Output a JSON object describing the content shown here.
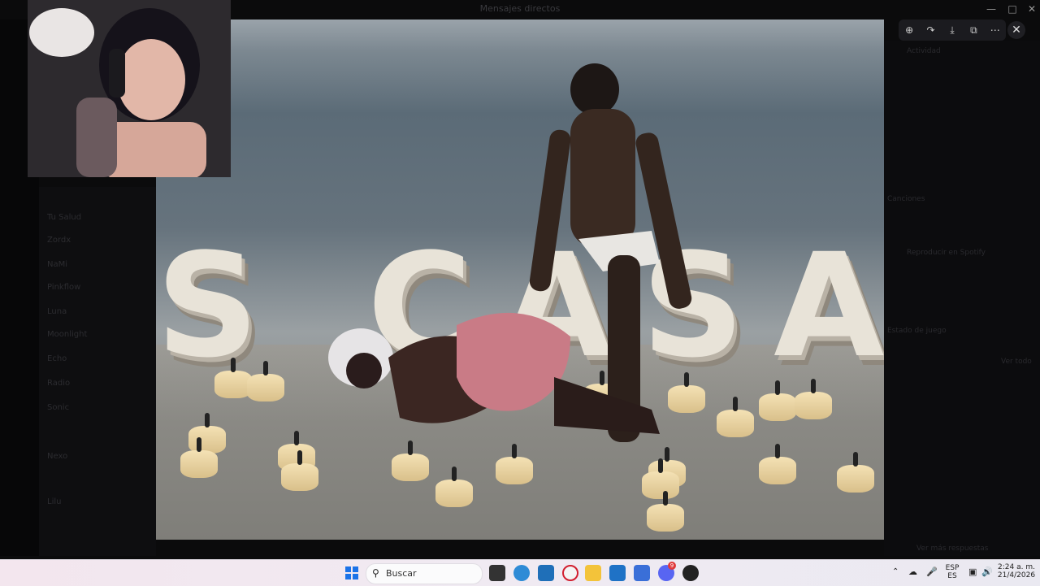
{
  "window": {
    "title": "Mensajes directos"
  },
  "background_app": {
    "channels": [
      "Tu Salud",
      "Zordx",
      "NaMi",
      "Pinkflow",
      "Luna",
      "Moonlight",
      "Echo",
      "Radio",
      "Sonic",
      "Nexo",
      "Lilu"
    ],
    "right_panel": [
      "Actividad",
      "Canciones",
      "Reproducir en Spotify",
      "Estado de juego",
      "Ver todo",
      "Ver más respuestas"
    ]
  },
  "viewer": {
    "toolbar": [
      "zoom-in-icon",
      "share-icon",
      "download-icon",
      "open-external-icon",
      "more-icon"
    ],
    "media_caption": "S CASAR"
  },
  "taskbar": {
    "search_placeholder": "Buscar",
    "language_top": "ESP",
    "language_bottom": "ES",
    "time": "2:24 a. m.",
    "date": "21/4/2026",
    "badge_count": "9"
  },
  "colors": {
    "accent": "#1a73e8",
    "taskbar_bg": "#f0eaf2",
    "app_bg": "#0b0b0c"
  }
}
